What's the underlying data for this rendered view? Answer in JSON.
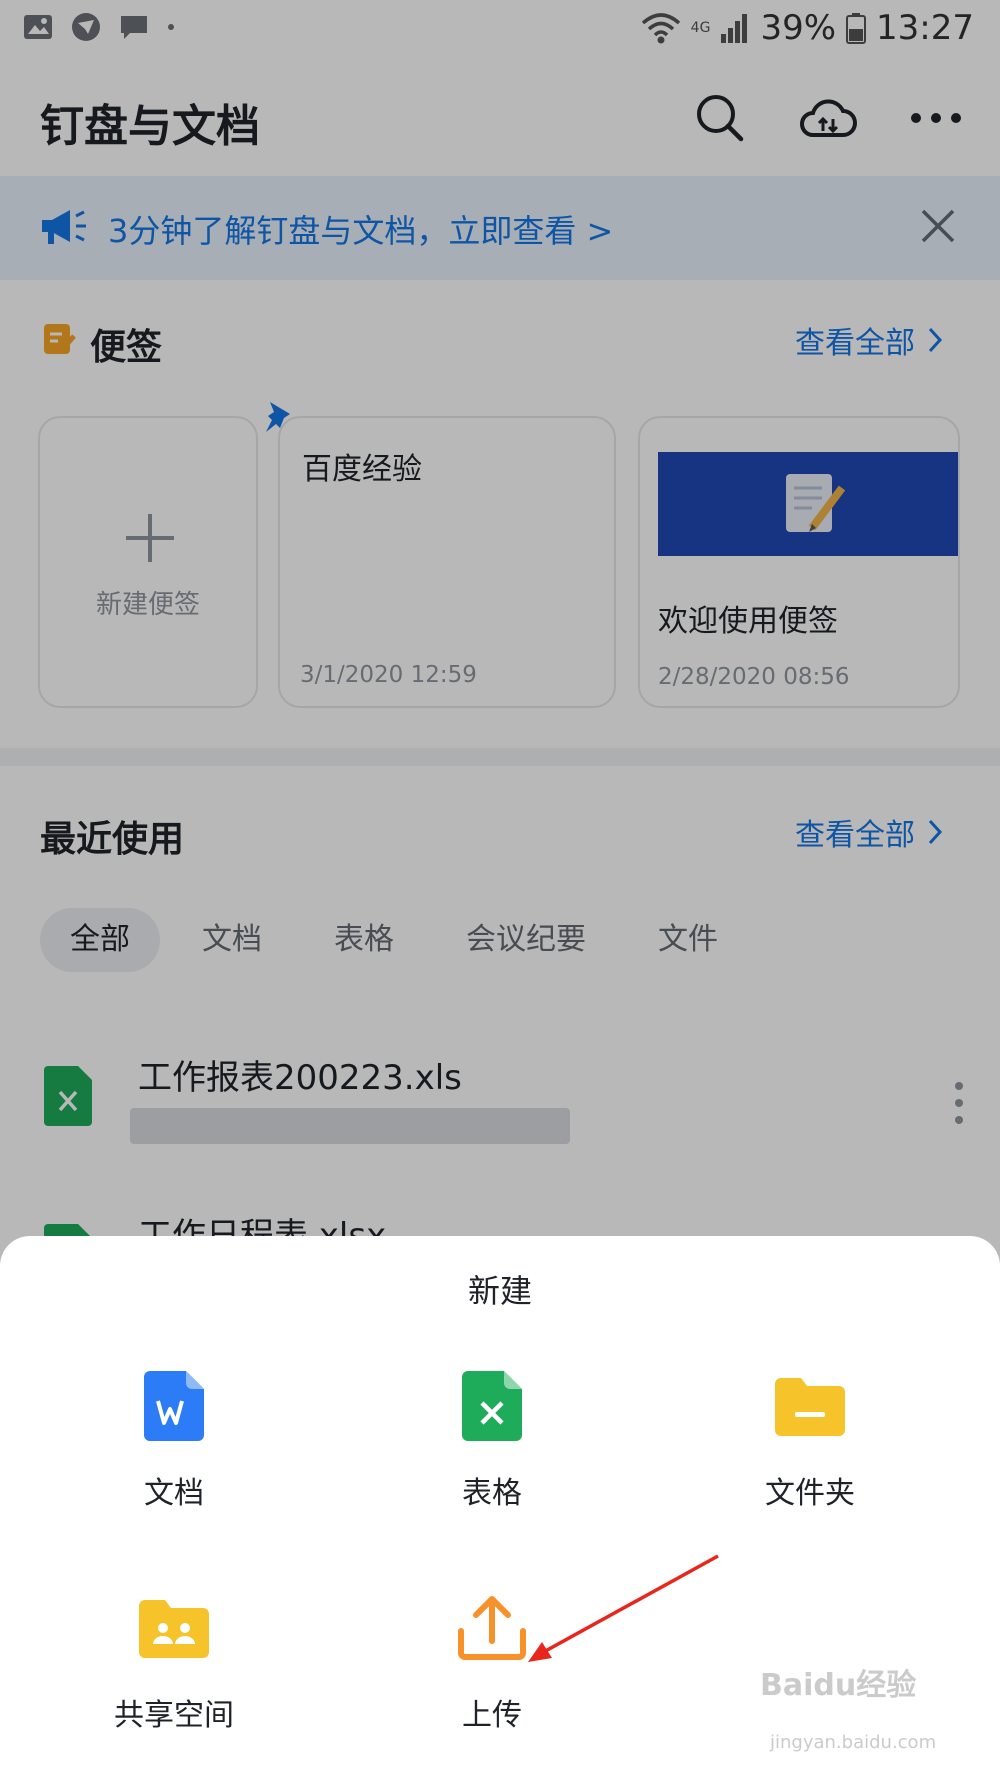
{
  "status_bar": {
    "battery": "39%",
    "time": "13:27",
    "network": "4G"
  },
  "header": {
    "title": "钉盘与文档"
  },
  "banner": {
    "text": "3分钟了解钉盘与文档，立即查看 >"
  },
  "notes": {
    "title": "便签",
    "view_all": "查看全部",
    "new_note_label": "新建便签",
    "cards": [
      {
        "title": "百度经验",
        "date": "3/1/2020 12:59"
      },
      {
        "title": "欢迎使用便签",
        "date": "2/28/2020 08:56"
      }
    ]
  },
  "recent": {
    "title": "最近使用",
    "view_all": "查看全部",
    "tabs": [
      "全部",
      "文档",
      "表格",
      "会议纪要",
      "文件"
    ],
    "active_tab": "全部",
    "files": [
      {
        "name": "工作报表200223.xls"
      },
      {
        "name": "工作日程表.xlsx"
      }
    ]
  },
  "sheet": {
    "title": "新建",
    "options": [
      {
        "label": "文档",
        "icon": "word-doc-icon"
      },
      {
        "label": "表格",
        "icon": "spreadsheet-icon"
      },
      {
        "label": "文件夹",
        "icon": "folder-icon"
      },
      {
        "label": "共享空间",
        "icon": "shared-space-icon"
      },
      {
        "label": "上传",
        "icon": "upload-icon"
      }
    ]
  },
  "watermark": {
    "brand": "Baidu经验",
    "url": "jingyan.baidu.com"
  },
  "colors": {
    "accent_blue": "#1677e5",
    "word_blue": "#2b7cf6",
    "excel_green": "#1eab5a",
    "folder_yellow": "#f7c32a",
    "upload_orange": "#f7912a",
    "arrow_red": "#e8261d"
  }
}
